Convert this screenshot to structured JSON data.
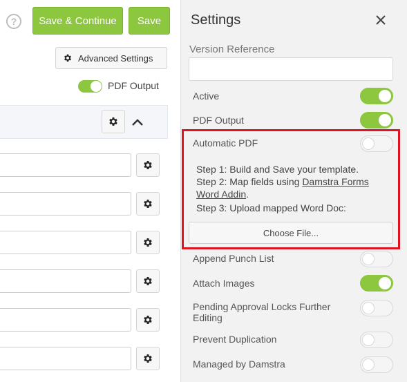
{
  "header": {
    "save_continue_label": "Save & Continue",
    "save_label": "Save",
    "help_glyph": "?"
  },
  "left": {
    "advanced_settings_label": "Advanced Settings",
    "pdf_output_label": "PDF Output",
    "pdf_output_on": true,
    "field_rows": 6
  },
  "settings": {
    "title": "Settings",
    "version_reference_label": "Version Reference",
    "version_reference_value": "",
    "toggles": {
      "active": {
        "label": "Active",
        "on": true
      },
      "pdf_output": {
        "label": "PDF Output",
        "on": true
      },
      "automatic_pdf": {
        "label": "Automatic PDF",
        "on": false
      },
      "append_punch_list": {
        "label": "Append Punch List",
        "on": false
      },
      "attach_images": {
        "label": "Attach Images",
        "on": true
      },
      "pending_approval": {
        "label": "Pending Approval Locks Further Editing",
        "on": false
      },
      "prevent_duplication": {
        "label": "Prevent Duplication",
        "on": false
      },
      "managed_by_damstra": {
        "label": "Managed by Damstra",
        "on": false
      }
    },
    "steps": {
      "step1": "Step 1: Build and Save your template.",
      "step2_prefix": "Step 2: Map fields using ",
      "step2_link": "Damstra Forms Word Addin",
      "step2_suffix": ".",
      "step3": "Step 3: Upload mapped Word Doc:"
    },
    "choose_file_label": "Choose File..."
  },
  "colors": {
    "accent_green": "#8dc63f",
    "highlight_red": "#e0141e",
    "panel_bg": "#f2f2f2"
  }
}
